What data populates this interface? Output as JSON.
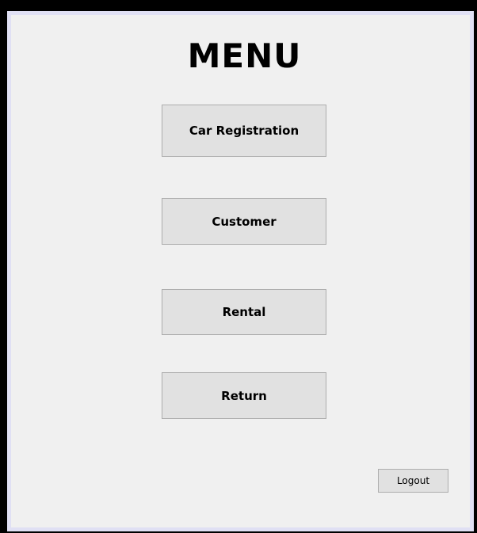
{
  "title": "MENU",
  "buttons": {
    "car_registration": "Car Registration",
    "customer": "Customer",
    "rental": "Rental",
    "return": "Return",
    "logout": "Logout"
  },
  "colors": {
    "frame": "#000000",
    "background": "#f0f0f0",
    "button_face": "#e1e1e1",
    "button_border": "#adadad"
  }
}
